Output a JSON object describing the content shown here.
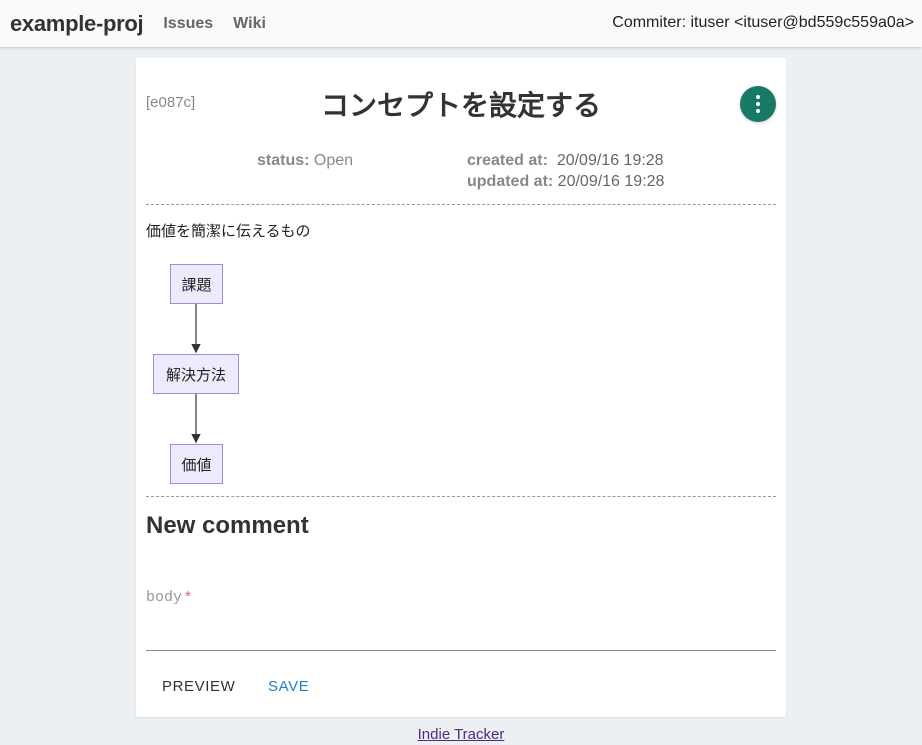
{
  "header": {
    "project": "example-proj",
    "nav": [
      "Issues",
      "Wiki"
    ],
    "committer": "Commiter: ituser <ituser@bd559c559a0a>"
  },
  "issue": {
    "id": "[e087c]",
    "title": "コンセプトを設定する",
    "status_label": "status:",
    "status_value": "Open",
    "created_label": "created at:",
    "created_value": "20/09/16 19:28",
    "updated_label": "updated at:",
    "updated_value": "20/09/16 19:28",
    "description": "価値を簡潔に伝えるもの",
    "flow": [
      "課題",
      "解決方法",
      "価値"
    ]
  },
  "comment": {
    "heading": "New comment",
    "body_label": "body",
    "required_mark": "*",
    "body_value": ""
  },
  "actions": {
    "preview": "PREVIEW",
    "save": "SAVE"
  },
  "footer": {
    "link": "Indie Tracker"
  },
  "colors": {
    "accent": "#167a66",
    "save": "#1e7fcc",
    "required": "#e35d5d"
  }
}
